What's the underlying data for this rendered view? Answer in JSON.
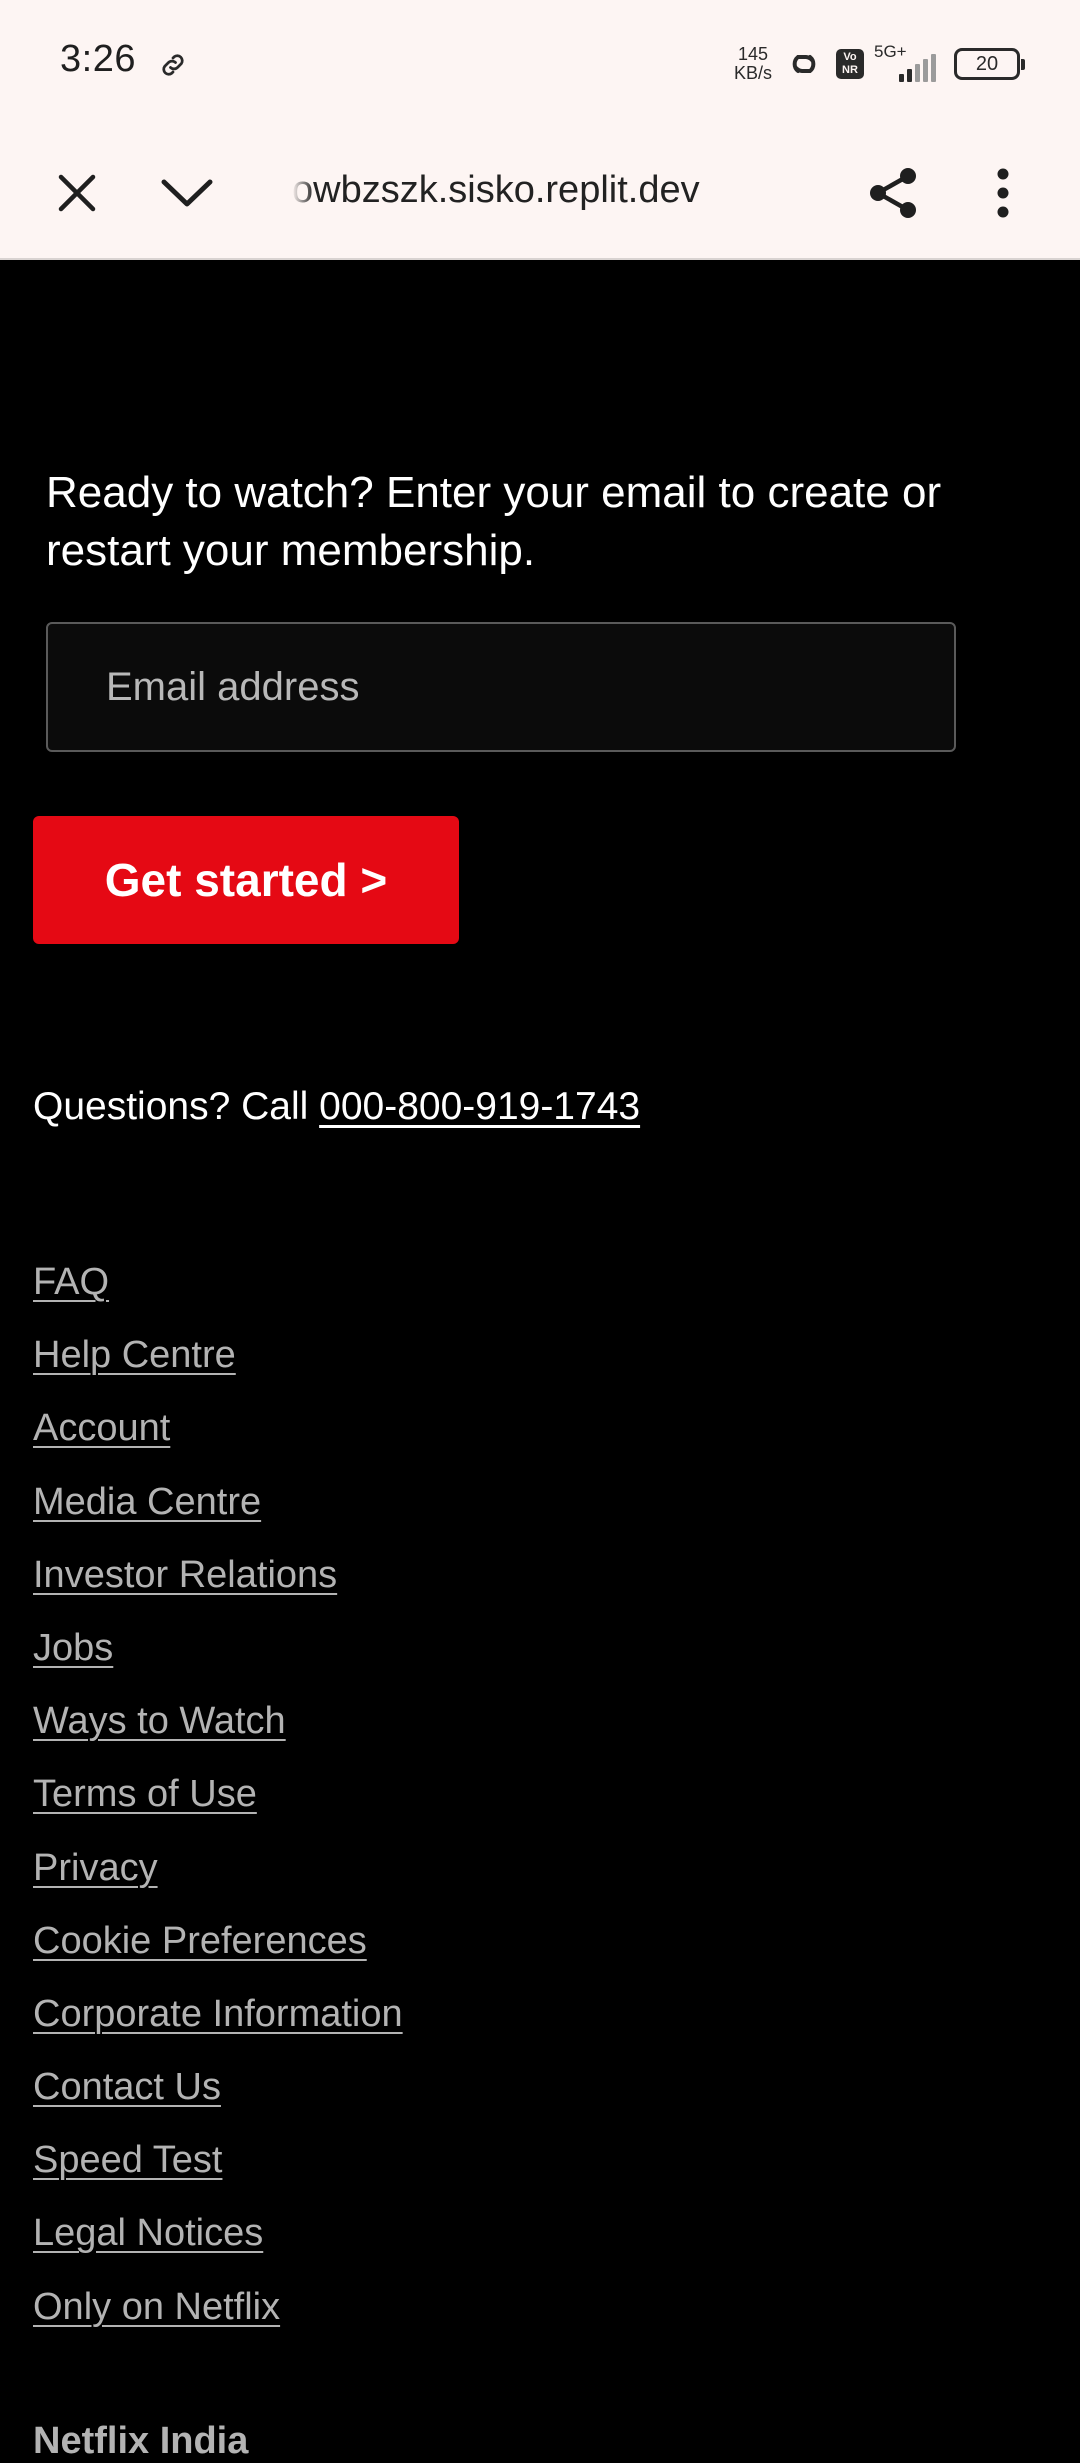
{
  "status_bar": {
    "time": "3:26",
    "net_speed_value": "145",
    "net_speed_unit": "KB/s",
    "volte_top": "Vo",
    "volte_bottom": "NR",
    "network_type": "5G+",
    "battery_level": "20"
  },
  "browser": {
    "url": "owbzszk.sisko.replit.dev",
    "icons": [
      "close-icon",
      "chevron-down-icon",
      "share-icon",
      "more-vert-icon"
    ]
  },
  "main": {
    "cta_text": "Ready to watch? Enter your email to create or restart your membership.",
    "email_placeholder": "Email address",
    "email_value": "",
    "get_started_label": "Get started >",
    "questions_prefix": "Questions? Call ",
    "phone_number": "000-800-919-1743"
  },
  "footer": {
    "links": [
      "FAQ",
      "Help Centre",
      "Account",
      "Media Centre",
      "Investor Relations",
      "Jobs",
      "Ways to Watch",
      "Terms of Use",
      "Privacy",
      "Cookie Preferences",
      "Corporate Information",
      "Contact Us",
      "Speed Test",
      "Legal Notices",
      "Only on Netflix"
    ],
    "country": "Netflix India"
  },
  "colors": {
    "brand_red": "#e50914",
    "background": "#000000",
    "chrome_bg": "#fdf5f3",
    "link_gray": "#b3b3b3"
  }
}
